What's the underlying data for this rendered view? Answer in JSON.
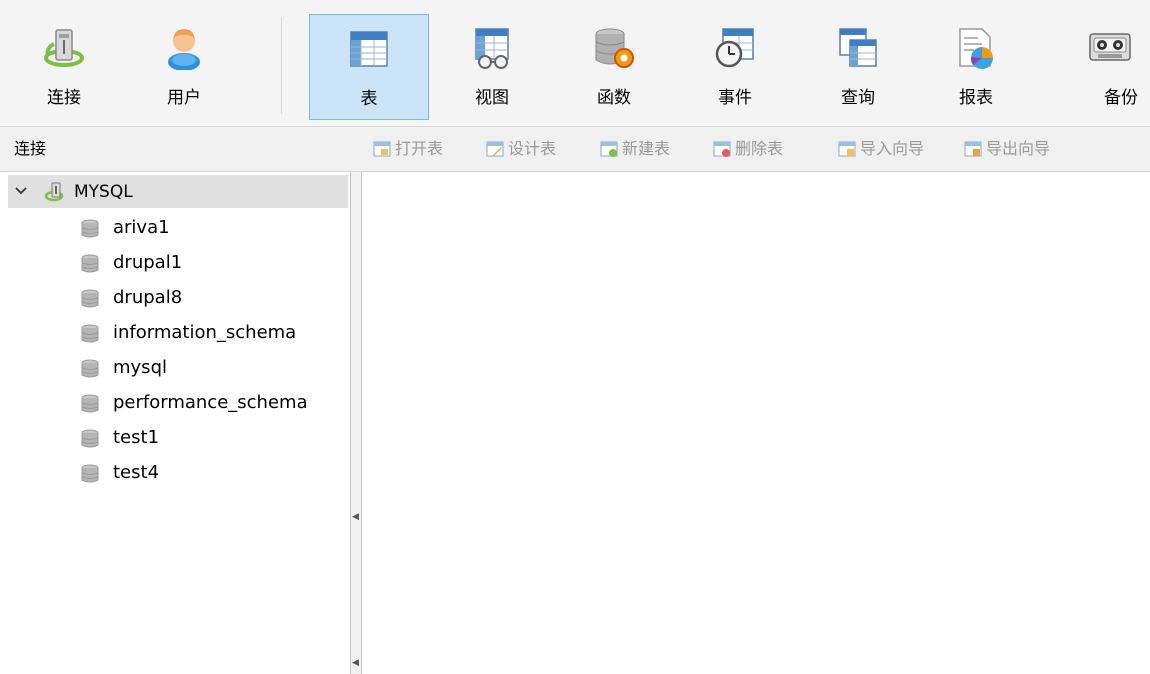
{
  "toolbar": {
    "buttons": [
      {
        "label": "连接",
        "icon": "connect-icon"
      },
      {
        "label": "用户",
        "icon": "user-icon"
      },
      {
        "label": "表",
        "icon": "table-icon",
        "active": true
      },
      {
        "label": "视图",
        "icon": "view-icon"
      },
      {
        "label": "函数",
        "icon": "function-icon"
      },
      {
        "label": "事件",
        "icon": "event-icon"
      },
      {
        "label": "查询",
        "icon": "query-icon"
      },
      {
        "label": "报表",
        "icon": "report-icon"
      },
      {
        "label": "备份",
        "icon": "backup-icon"
      }
    ]
  },
  "subbar": {
    "heading": "连接",
    "actions": [
      {
        "label": "打开表",
        "icon": "open-table-icon"
      },
      {
        "label": "设计表",
        "icon": "design-table-icon"
      },
      {
        "label": "新建表",
        "icon": "new-table-icon"
      },
      {
        "label": "删除表",
        "icon": "delete-table-icon"
      },
      {
        "label": "导入向导",
        "icon": "import-wizard-icon"
      },
      {
        "label": "导出向导",
        "icon": "export-wizard-icon"
      }
    ]
  },
  "tree": {
    "connection": "MYSQL",
    "databases": [
      "ariva1",
      "drupal1",
      "drupal8",
      "information_schema",
      "mysql",
      "performance_schema",
      "test1",
      "test4"
    ]
  },
  "colors": {
    "active_bg": "#cce4f7",
    "active_border": "#7eb4ea",
    "selected_row": "#e0e0e0",
    "disabled_text": "#999999"
  }
}
